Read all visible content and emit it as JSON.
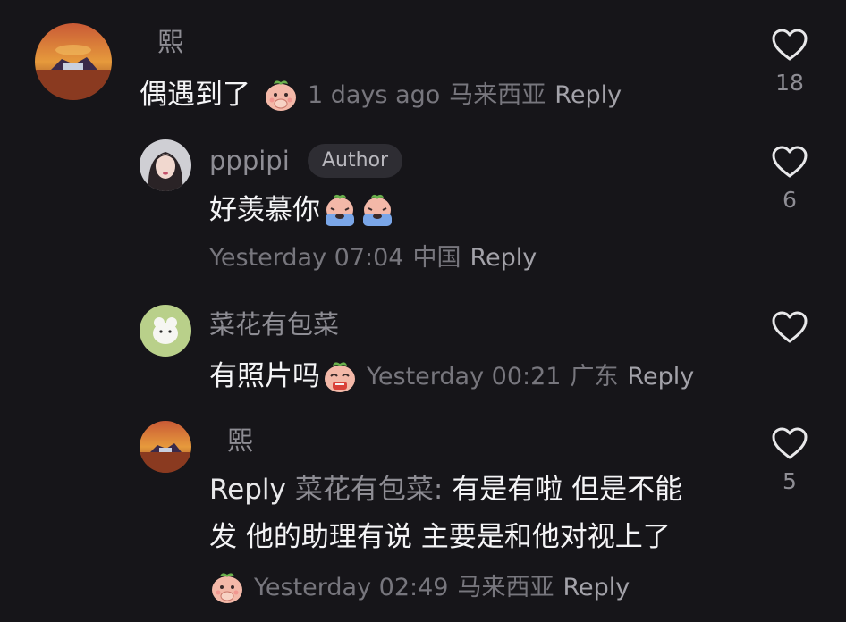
{
  "comments": [
    {
      "username": "熙",
      "text": "偶遇到了",
      "emoji": "peach-cover-mouth-emoji",
      "time": "1 days ago",
      "location": "马来西亚",
      "reply_label": "Reply",
      "likes": "18",
      "is_author": false
    },
    {
      "username": "pppipi",
      "badge": "Author",
      "text": "好羡慕你",
      "emoji": "crying-emoji",
      "time": "Yesterday 07:04",
      "location": "中国",
      "reply_label": "Reply",
      "likes": "6",
      "is_author": true
    },
    {
      "username": "菜花有包菜",
      "text": "有照片吗",
      "emoji": "peach-pleading-emoji",
      "time": "Yesterday 00:21",
      "location": "广东",
      "reply_label": "Reply",
      "likes": "",
      "is_author": false
    },
    {
      "username": "熙",
      "reply_prefix": "Reply",
      "reply_to": "菜花有包菜:",
      "text_line1": "有是有啦 但是不能",
      "text_line2": "发 他的助理有说 主要是和他对视上了",
      "emoji": "peach-cover-mouth-emoji",
      "time": "Yesterday 02:49",
      "location": "马来西亚",
      "reply_label": "Reply",
      "likes": "5",
      "is_author": false
    }
  ],
  "icons": {
    "like": "heart-outline-icon"
  },
  "colors": {
    "background": "#161519",
    "text_primary": "#f4f4f6",
    "text_secondary": "#8e8d94",
    "text_meta": "#77767d"
  }
}
